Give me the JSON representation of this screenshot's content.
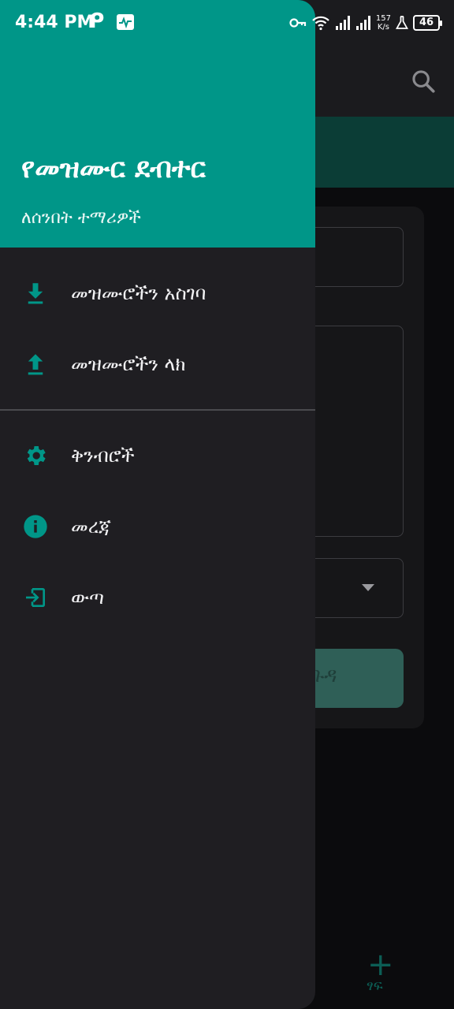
{
  "status_bar": {
    "time": "4:44 PM",
    "net_speed_value": "157",
    "net_speed_unit": "K/s",
    "battery": "46",
    "icons": [
      "p-app-icon",
      "activity-icon",
      "vpn-key-icon",
      "wifi-icon",
      "signal-icon",
      "signal-icon",
      "flask-icon",
      "battery-icon"
    ]
  },
  "drawer": {
    "title": "የመዝሙር ደብተር",
    "subtitle": "ለሰንበት ተማሪዎች",
    "section1": [
      {
        "label": "መዝሙሮችን አስገባ",
        "icon": "download-icon"
      },
      {
        "label": "መዝሙሮችን ላክ",
        "icon": "upload-icon"
      }
    ],
    "section2": [
      {
        "label": "ቅንብሮች",
        "icon": "gear-icon"
      },
      {
        "label": "መረጃ",
        "icon": "info-icon"
      },
      {
        "label": "ውጣ",
        "icon": "logout-icon"
      }
    ]
  },
  "background": {
    "submit_label": "ጉዳ",
    "fab_label": "ፃፍ",
    "fab_icon": "plus-icon"
  },
  "colors": {
    "accent": "#009688",
    "drawer_bg": "#1f1e22",
    "screen_bg": "#0b0b0d"
  }
}
